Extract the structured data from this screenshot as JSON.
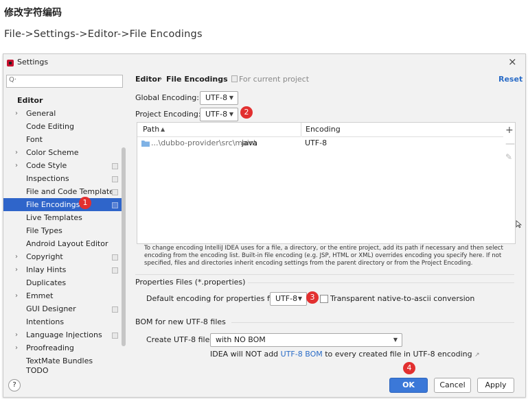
{
  "doc": {
    "title": "修改字符编码",
    "path": "File->Settings->Editor->File Encodings"
  },
  "window": {
    "title": "Settings",
    "close": "×"
  },
  "search": {
    "icon": "Q·"
  },
  "sidebar": {
    "group": "Editor",
    "items": [
      {
        "label": "General",
        "arrow": "›"
      },
      {
        "label": "Code Editing"
      },
      {
        "label": "Font"
      },
      {
        "label": "Color Scheme",
        "arrow": "›"
      },
      {
        "label": "Code Style",
        "arrow": "›"
      },
      {
        "label": "Inspections"
      },
      {
        "label": "File and Code Templates"
      },
      {
        "label": "File Encodings"
      },
      {
        "label": "Live Templates"
      },
      {
        "label": "File Types"
      },
      {
        "label": "Android Layout Editor"
      },
      {
        "label": "Copyright",
        "arrow": "›"
      },
      {
        "label": "Inlay Hints",
        "arrow": "›"
      },
      {
        "label": "Duplicates"
      },
      {
        "label": "Emmet",
        "arrow": "›"
      },
      {
        "label": "GUI Designer"
      },
      {
        "label": "Intentions"
      },
      {
        "label": "Language Injections",
        "arrow": "›"
      },
      {
        "label": "Proofreading",
        "arrow": "›"
      },
      {
        "label": "TextMate Bundles"
      },
      {
        "label": "TODO"
      }
    ]
  },
  "header": {
    "crumb_parent": "Editor",
    "crumb_sep": "›",
    "crumb_current": "File Encodings",
    "scope": "For current project",
    "reset": "Reset"
  },
  "encodings": {
    "global_label": "Global Encoding:",
    "global_value": "UTF-8",
    "project_label": "Project Encoding:",
    "project_value": "UTF-8",
    "dropdown_arrow": "▼"
  },
  "table": {
    "col_path": "Path",
    "sort_indicator": "▲",
    "col_encoding": "Encoding",
    "rows": [
      {
        "path_prefix": "...\\dubbo-provider\\src\\main\\",
        "path_last": "java",
        "encoding": "UTF-8"
      }
    ],
    "tools": {
      "add": "+",
      "remove": "—",
      "edit": "✎"
    }
  },
  "help_text": "To change encoding IntelliJ IDEA uses for a file, a directory, or the entire project, add its path if necessary and then select encoding from the encoding list. Built-in file encoding (e.g. JSP, HTML or XML) overrides encoding you specify here. If not specified, files and directories inherit encoding settings from the parent directory or from the Project Encoding.",
  "properties": {
    "title": "Properties Files (*.properties)",
    "default_label": "Default encoding for properties files:",
    "default_value": "UTF-8",
    "checkbox_label": "Transparent native-to-ascii conversion"
  },
  "bom": {
    "title": "BOM for new UTF-8 files",
    "create_label": "Create UTF-8 files:",
    "create_value": "with NO BOM",
    "note_prefix": "IDEA will NOT add ",
    "note_link": "UTF-8 BOM",
    "note_suffix": " to every created file in UTF-8 encoding",
    "note_arrow": "↗"
  },
  "badges": [
    "1",
    "2",
    "3",
    "4"
  ],
  "footer": {
    "help": "?",
    "ok": "OK",
    "cancel": "Cancel",
    "apply": "Apply"
  },
  "colors": {
    "accent": "#2f65ca",
    "badge": "#e23030",
    "link": "#2a6cc7"
  }
}
